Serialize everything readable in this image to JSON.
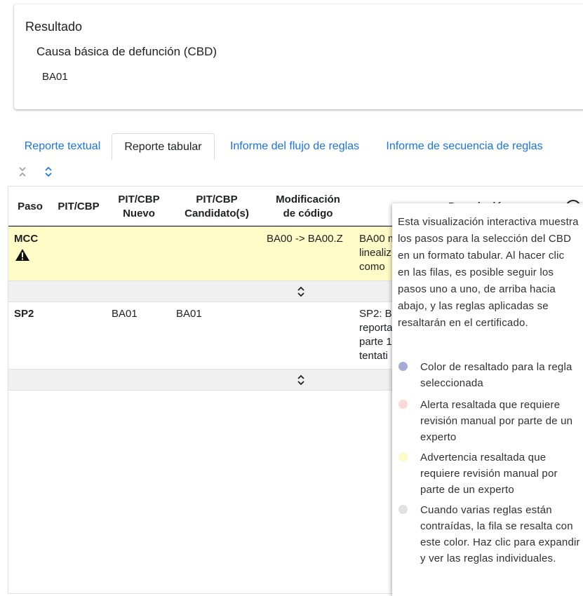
{
  "result": {
    "title": "Resultado",
    "subtitle": "Causa básica de defunción (CBD)",
    "value": "BA01"
  },
  "tabs": [
    {
      "label": "Reporte textual",
      "active": false
    },
    {
      "label": "Reporte tabular",
      "active": true
    },
    {
      "label": "Informe del flujo de reglas",
      "active": false
    },
    {
      "label": "Informe de secuencia de reglas",
      "active": false
    }
  ],
  "controls": {
    "collapse_all_icon": "collapse-all-icon",
    "expand_all_icon": "expand-all-icon"
  },
  "table": {
    "headers": {
      "paso": "Paso",
      "pit": "PIT/CBP",
      "pit_nuevo": [
        "PIT/CBP",
        "Nuevo"
      ],
      "candidatos": [
        "PIT/CBP",
        "Candidato(s)"
      ],
      "modificacion": [
        "Modificación",
        "de código"
      ],
      "descripcion": "Descripción"
    },
    "rows": [
      {
        "paso": "MCC",
        "warning_icon": "warning-icon",
        "pit": "",
        "pit_nuevo": "",
        "candidatos": "",
        "modificacion": "BA00 -> BA00.Z",
        "descripcion": "BA00 m\nlinealiz\ncomo",
        "highlight": "warning"
      },
      {
        "paso": "SP2",
        "pit": "",
        "pit_nuevo": "BA01",
        "candidatos": "BA01",
        "modificacion": "",
        "descripcion": "SP2: B\nreporta\nparte 1\ntentati",
        "highlight": "none"
      }
    ],
    "expander_icon": "unfold-more-icon"
  },
  "tooltip": {
    "intro": "Esta visualización interactiva muestra los pasos para la selección del CBD en un formato tabular. Al hacer clic en las filas, es posible seguir los pasos uno a uno, de arriba hacia abajo, y las reglas aplicadas se resaltarán en el certificado.",
    "legend": [
      {
        "text": "Color de resaltado para la regla seleccionada",
        "color": "#a3acd8"
      },
      {
        "text": "Alerta resaltada que requiere revisión manual por parte de un experto",
        "color": "#fbd9d9"
      },
      {
        "text": "Advertencia resaltada que requiere revisión manual por parte de un experto",
        "color": "#fdfbc6"
      },
      {
        "text": "Cuando varias reglas están contraídas, la fila se resalta con este color. Haz clic para expandir y ver las reglas individuales.",
        "color": "#e0e0e0"
      }
    ]
  },
  "colors": {
    "link": "#1a73e8",
    "warning_row": "#fffcc8",
    "collapsed_row": "#f0f0f0"
  }
}
